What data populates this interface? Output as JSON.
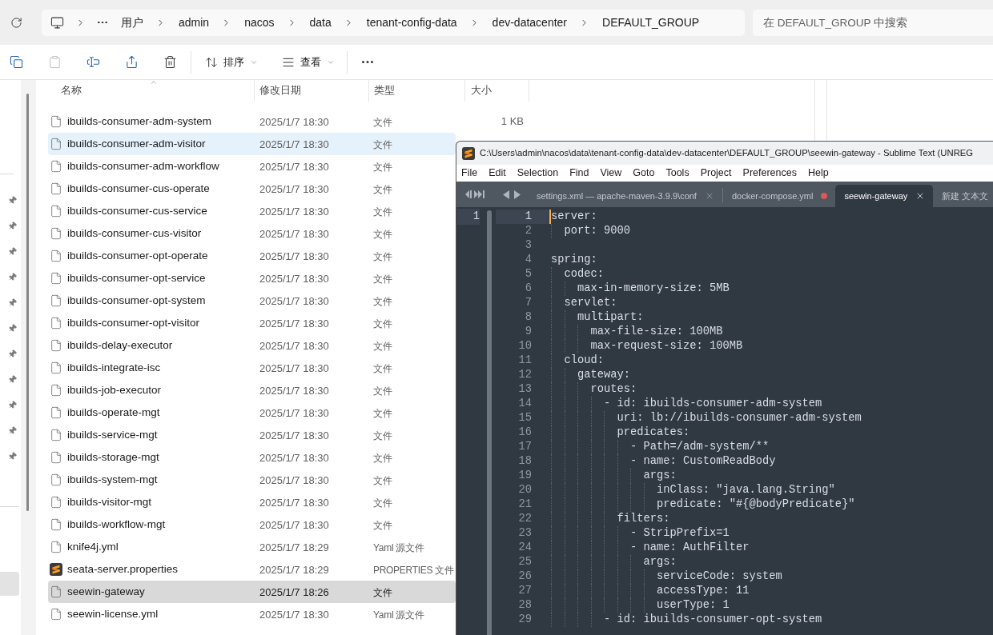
{
  "explorer": {
    "address_bar": {
      "breadcrumbs": [
        "用户",
        "admin",
        "nacos",
        "data",
        "tenant-config-data",
        "dev-datacenter",
        "DEFAULT_GROUP"
      ]
    },
    "search": {
      "placeholder": "在 DEFAULT_GROUP 中搜索"
    },
    "toolbar": {
      "actions": [
        {
          "kind": "copy",
          "disabled": false
        },
        {
          "kind": "paste",
          "disabled": true
        },
        {
          "kind": "rename",
          "disabled": false
        },
        {
          "kind": "share",
          "disabled": false
        },
        {
          "kind": "delete",
          "disabled": false
        }
      ],
      "menus": [
        {
          "kind": "sort",
          "label": "排序"
        },
        {
          "kind": "view",
          "label": "查看"
        }
      ]
    },
    "navigation_pane": {
      "quick_access": [
        {
          "pinned": true
        },
        {
          "pinned": true
        },
        {
          "pinned": true
        },
        {
          "pinned": true
        },
        {
          "pinned": true
        },
        {
          "pinned": true
        },
        {
          "pinned": true
        },
        {
          "pinned": true
        },
        {
          "pinned": true
        },
        {
          "pinned": true
        },
        {
          "pinned": true
        }
      ],
      "locations": [
        {
          "selected": true
        }
      ]
    },
    "files": {
      "columns": [
        {
          "label": "名称",
          "sorted": true
        },
        {
          "label": "修改日期",
          "sorted": false
        },
        {
          "label": "类型",
          "sorted": false
        },
        {
          "label": "大小",
          "sorted": false
        }
      ],
      "rows": [
        {
          "kind": "file",
          "name": "ibuilds-consumer-adm-system",
          "modified": "2025/1/7 18:30",
          "type": "文件",
          "size": "1 KB",
          "selected": false,
          "hovered": false
        },
        {
          "kind": "file",
          "name": "ibuilds-consumer-adm-visitor",
          "modified": "2025/1/7 18:30",
          "type": "文件",
          "selected": false,
          "hovered": true
        },
        {
          "kind": "file",
          "name": "ibuilds-consumer-adm-workflow",
          "modified": "2025/1/7 18:30",
          "type": "文件",
          "selected": false,
          "hovered": false
        },
        {
          "kind": "file",
          "name": "ibuilds-consumer-cus-operate",
          "modified": "2025/1/7 18:30",
          "type": "文件",
          "selected": false,
          "hovered": false
        },
        {
          "kind": "file",
          "name": "ibuilds-consumer-cus-service",
          "modified": "2025/1/7 18:30",
          "type": "文件",
          "selected": false,
          "hovered": false
        },
        {
          "kind": "file",
          "name": "ibuilds-consumer-cus-visitor",
          "modified": "2025/1/7 18:30",
          "type": "文件",
          "selected": false,
          "hovered": false
        },
        {
          "kind": "file",
          "name": "ibuilds-consumer-opt-operate",
          "modified": "2025/1/7 18:30",
          "type": "文件",
          "selected": false,
          "hovered": false
        },
        {
          "kind": "file",
          "name": "ibuilds-consumer-opt-service",
          "modified": "2025/1/7 18:30",
          "type": "文件",
          "selected": false,
          "hovered": false
        },
        {
          "kind": "file",
          "name": "ibuilds-consumer-opt-system",
          "modified": "2025/1/7 18:30",
          "type": "文件",
          "selected": false,
          "hovered": false
        },
        {
          "kind": "file",
          "name": "ibuilds-consumer-opt-visitor",
          "modified": "2025/1/7 18:30",
          "type": "文件",
          "selected": false,
          "hovered": false
        },
        {
          "kind": "file",
          "name": "ibuilds-delay-executor",
          "modified": "2025/1/7 18:30",
          "type": "文件",
          "selected": false,
          "hovered": false
        },
        {
          "kind": "file",
          "name": "ibuilds-integrate-isc",
          "modified": "2025/1/7 18:30",
          "type": "文件",
          "selected": false,
          "hovered": false
        },
        {
          "kind": "file",
          "name": "ibuilds-job-executor",
          "modified": "2025/1/7 18:30",
          "type": "文件",
          "selected": false,
          "hovered": false
        },
        {
          "kind": "file",
          "name": "ibuilds-operate-mgt",
          "modified": "2025/1/7 18:30",
          "type": "文件",
          "selected": false,
          "hovered": false
        },
        {
          "kind": "file",
          "name": "ibuilds-service-mgt",
          "modified": "2025/1/7 18:30",
          "type": "文件",
          "selected": false,
          "hovered": false
        },
        {
          "kind": "file",
          "name": "ibuilds-storage-mgt",
          "modified": "2025/1/7 18:30",
          "type": "文件",
          "selected": false,
          "hovered": false
        },
        {
          "kind": "file",
          "name": "ibuilds-system-mgt",
          "modified": "2025/1/7 18:30",
          "type": "文件",
          "selected": false,
          "hovered": false
        },
        {
          "kind": "file",
          "name": "ibuilds-visitor-mgt",
          "modified": "2025/1/7 18:30",
          "type": "文件",
          "selected": false,
          "hovered": false
        },
        {
          "kind": "file",
          "name": "ibuilds-workflow-mgt",
          "modified": "2025/1/7 18:30",
          "type": "文件",
          "selected": false,
          "hovered": false
        },
        {
          "kind": "file",
          "name": "knife4j.yml",
          "modified": "2025/1/7 18:29",
          "type": "Yaml 源文件",
          "selected": false,
          "hovered": false
        },
        {
          "kind": "sublime",
          "name": "seata-server.properties",
          "modified": "2025/1/7 18:29",
          "type": "PROPERTIES 文件",
          "selected": false,
          "hovered": false
        },
        {
          "kind": "file",
          "name": "seewin-gateway",
          "modified": "2025/1/7 18:26",
          "type": "文件",
          "selected": true,
          "hovered": false
        },
        {
          "kind": "file",
          "name": "seewin-license.yml",
          "modified": "2025/1/7 18:30",
          "type": "Yaml 源文件",
          "selected": false,
          "hovered": false
        }
      ]
    }
  },
  "editor": {
    "title": "C:\\Users\\admin\\nacos\\data\\tenant-config-data\\dev-datacenter\\DEFAULT_GROUP\\seewin-gateway - Sublime Text (UNREG",
    "menu": [
      "File",
      "Edit",
      "Selection",
      "Find",
      "View",
      "Goto",
      "Tools",
      "Project",
      "Preferences",
      "Help"
    ],
    "tabs": [
      {
        "label": "settings.xml — apache-maven-3.9.9\\conf",
        "selected": false,
        "closable": true,
        "modified": false
      },
      {
        "label": "docker-compose.yml",
        "selected": false,
        "closable": false,
        "modified": true
      },
      {
        "label": "seewin-gateway",
        "selected": true,
        "closable": true,
        "modified": false
      },
      {
        "label": "新建 文本文",
        "selected": false,
        "closable": false,
        "modified": false
      }
    ],
    "side_group": {
      "lines": [
        {
          "number": "1",
          "current": true
        }
      ]
    },
    "lines": [
      {
        "number": "1",
        "text": "server:",
        "current": true
      },
      {
        "number": "2",
        "text": "  port: 9000",
        "current": false
      },
      {
        "number": "3",
        "current": false
      },
      {
        "number": "4",
        "text": "spring:",
        "current": false
      },
      {
        "number": "5",
        "text": "  codec:",
        "current": false
      },
      {
        "number": "6",
        "text": "    max-in-memory-size: 5MB",
        "current": false
      },
      {
        "number": "7",
        "text": "  servlet:",
        "current": false
      },
      {
        "number": "8",
        "text": "    multipart:",
        "current": false
      },
      {
        "number": "9",
        "text": "      max-file-size: 100MB",
        "current": false
      },
      {
        "number": "10",
        "text": "      max-request-size: 100MB",
        "current": false
      },
      {
        "number": "11",
        "text": "  cloud:",
        "current": false
      },
      {
        "number": "12",
        "text": "    gateway:",
        "current": false
      },
      {
        "number": "13",
        "text": "      routes:",
        "current": false
      },
      {
        "number": "14",
        "text": "        - id: ibuilds-consumer-adm-system",
        "current": false
      },
      {
        "number": "15",
        "text": "          uri: lb://ibuilds-consumer-adm-system",
        "current": false
      },
      {
        "number": "16",
        "text": "          predicates:",
        "current": false
      },
      {
        "number": "17",
        "text": "            - Path=/adm-system/**",
        "current": false
      },
      {
        "number": "18",
        "text": "            - name: CustomReadBody",
        "current": false
      },
      {
        "number": "19",
        "text": "              args:",
        "current": false
      },
      {
        "number": "20",
        "text": "                inClass: \"java.lang.String\"",
        "current": false
      },
      {
        "number": "21",
        "text": "                predicate: \"#{@bodyPredicate}\"",
        "current": false
      },
      {
        "number": "22",
        "text": "          filters:",
        "current": false
      },
      {
        "number": "23",
        "text": "            - StripPrefix=1",
        "current": false
      },
      {
        "number": "24",
        "text": "            - name: AuthFilter",
        "current": false
      },
      {
        "number": "25",
        "text": "              args:",
        "current": false
      },
      {
        "number": "26",
        "text": "                serviceCode: system",
        "current": false
      },
      {
        "number": "27",
        "text": "                accessType: 11",
        "current": false
      },
      {
        "number": "28",
        "text": "                userType: 1",
        "current": false
      },
      {
        "number": "29",
        "text": "        - id: ibuilds-consumer-opt-system",
        "current": false
      }
    ]
  }
}
